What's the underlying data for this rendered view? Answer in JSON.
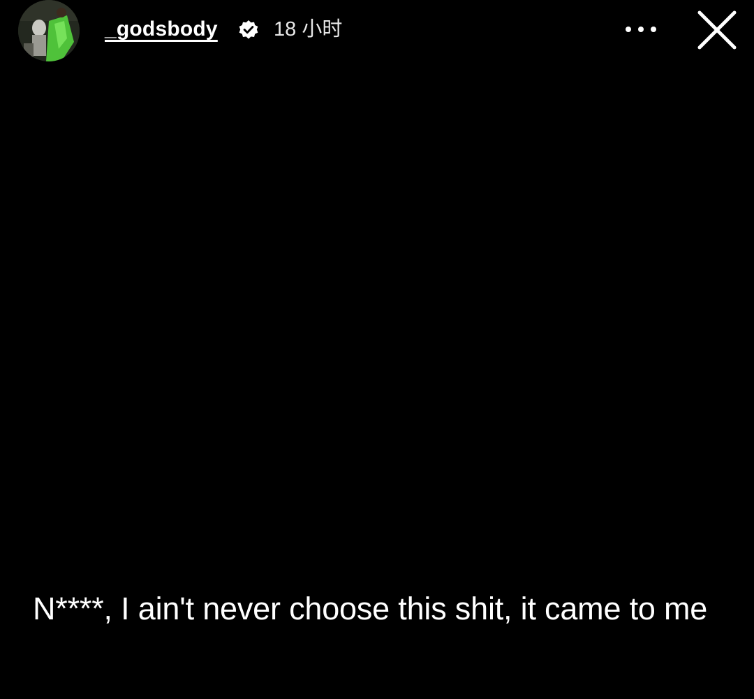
{
  "story": {
    "header": {
      "username": "_godsbody",
      "timestamp": "18 小时",
      "verified_icon": "verified-badge-icon",
      "more_icon": "more-horizontal-icon",
      "close_icon": "close-icon"
    },
    "caption": "N****, I ain't never choose this shit, it came to me"
  },
  "colors": {
    "background": "#000000",
    "text": "#ffffff",
    "avatar_accent": "#4fc23a"
  }
}
